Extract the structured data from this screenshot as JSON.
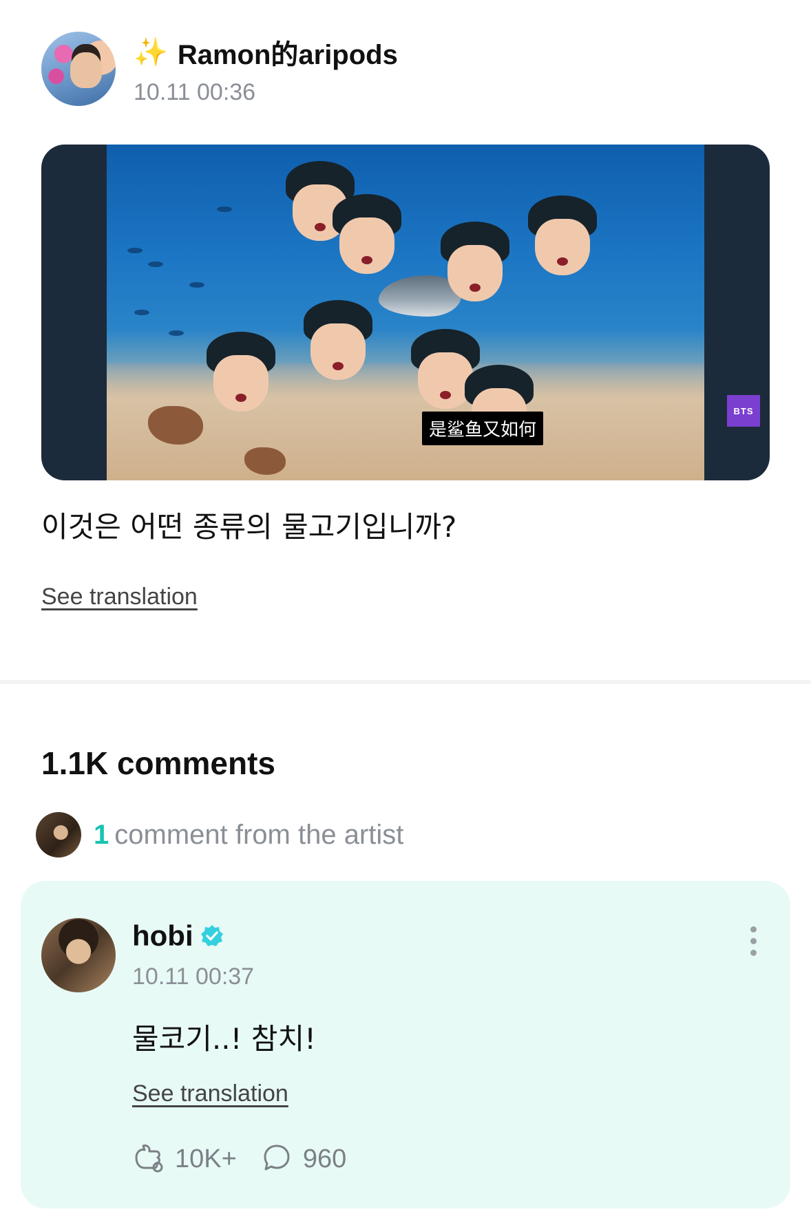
{
  "post": {
    "author_name": "Ramon的aripods",
    "author_emoji": "✨",
    "timestamp": "10.11 00:36",
    "media_caption": "是鲨鱼又如何",
    "media_badge": "BTS",
    "text": "이것은 어떤 종류의 물고기입니까?",
    "see_translation": "See translation"
  },
  "comments": {
    "title": "1.1K comments",
    "artist_summary_count": "1",
    "artist_summary_text": "comment from the artist"
  },
  "artist_comment": {
    "name": "hobi",
    "timestamp": "10.11 00:37",
    "text": "물코기..! 참치!",
    "see_translation": "See translation",
    "likes": "10K+",
    "replies": "960",
    "verified_color": "#35d0e0"
  }
}
